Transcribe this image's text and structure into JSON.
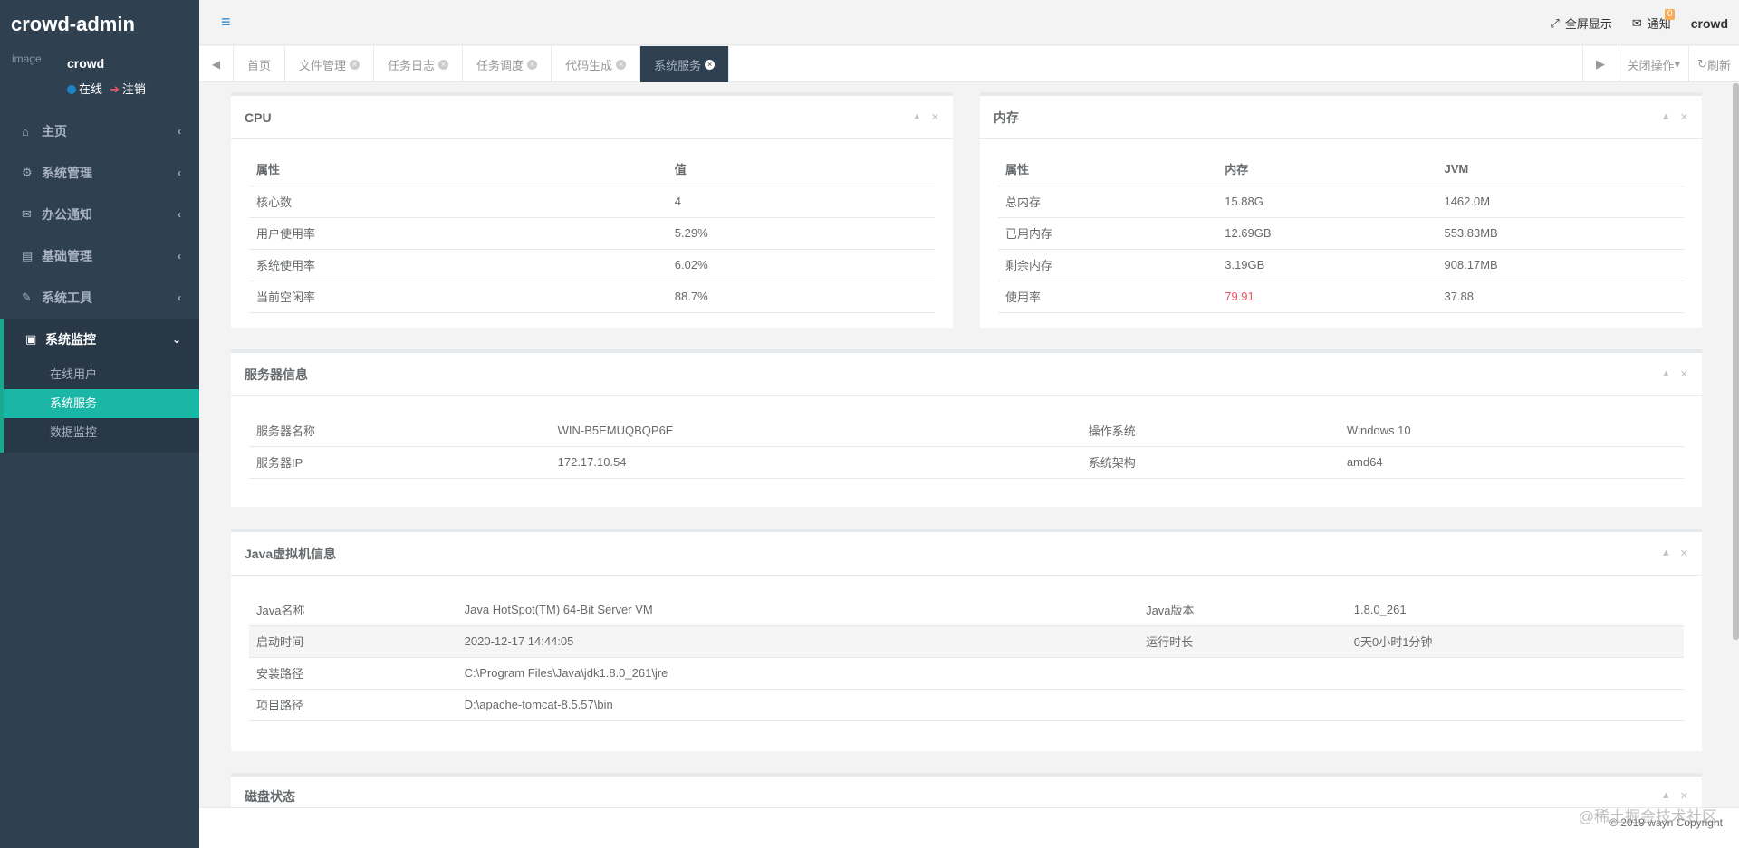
{
  "app": {
    "brand": "crowd-admin"
  },
  "profile": {
    "avatar_alt": "image",
    "username": "crowd",
    "online_label": "在线",
    "logout_label": "注销"
  },
  "sidebar": {
    "items": [
      {
        "label": "主页"
      },
      {
        "label": "系统管理"
      },
      {
        "label": "办公通知"
      },
      {
        "label": "基础管理"
      },
      {
        "label": "系统工具"
      },
      {
        "label": "系统监控"
      }
    ],
    "sub_items": [
      {
        "label": "在线用户"
      },
      {
        "label": "系统服务"
      },
      {
        "label": "数据监控"
      }
    ]
  },
  "topbar": {
    "fullscreen_label": "全屏显示",
    "notify_label": "通知",
    "notify_count": "0",
    "user": "crowd"
  },
  "tabs": {
    "items": [
      {
        "label": "首页"
      },
      {
        "label": "文件管理"
      },
      {
        "label": "任务日志"
      },
      {
        "label": "任务调度"
      },
      {
        "label": "代码生成"
      },
      {
        "label": "系统服务"
      }
    ],
    "close_ops_label": "关闭操作",
    "refresh_label": "刷新"
  },
  "cpu": {
    "title": "CPU",
    "headers": [
      "属性",
      "值"
    ],
    "rows": [
      [
        "核心数",
        "4"
      ],
      [
        "用户使用率",
        "5.29%"
      ],
      [
        "系统使用率",
        "6.02%"
      ],
      [
        "当前空闲率",
        "88.7%"
      ]
    ]
  },
  "memory": {
    "title": "内存",
    "headers": [
      "属性",
      "内存",
      "JVM"
    ],
    "rows": [
      [
        "总内存",
        "15.88G",
        "1462.0M"
      ],
      [
        "已用内存",
        "12.69GB",
        "553.83MB"
      ],
      [
        "剩余内存",
        "3.19GB",
        "908.17MB"
      ],
      [
        "使用率",
        "79.91",
        "37.88"
      ]
    ]
  },
  "server": {
    "title": "服务器信息",
    "rows": [
      [
        "服务器名称",
        "WIN-B5EMUQBQP6E",
        "操作系统",
        "Windows 10"
      ],
      [
        "服务器IP",
        "172.17.10.54",
        "系统架构",
        "amd64"
      ]
    ]
  },
  "jvm": {
    "title": "Java虚拟机信息",
    "rows": [
      [
        "Java名称",
        "Java HotSpot(TM) 64-Bit Server VM",
        "Java版本",
        "1.8.0_261"
      ],
      [
        "启动时间",
        "2020-12-17 14:44:05",
        "运行时长",
        "0天0小时1分钟"
      ]
    ],
    "path_rows": [
      [
        "安装路径",
        "C:\\Program Files\\Java\\jdk1.8.0_261\\jre"
      ],
      [
        "项目路径",
        "D:\\apache-tomcat-8.5.57\\bin"
      ]
    ]
  },
  "disk": {
    "title": "磁盘状态"
  },
  "footer": {
    "copyright": "© 2019 wayn Copyright"
  },
  "watermark": "@稀土掘金技术社区"
}
